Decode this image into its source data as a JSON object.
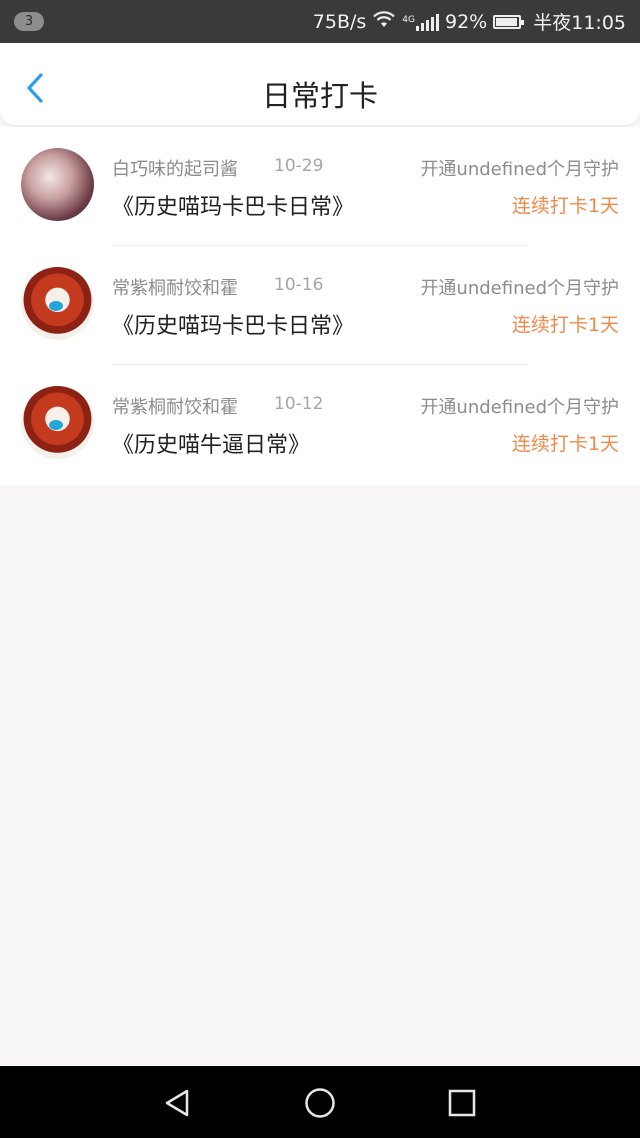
{
  "status_bar": {
    "notification_count": "3",
    "net_speed": "75B/s",
    "network_tag": "4G",
    "battery": "92%",
    "time": "半夜11:05",
    "icons": [
      "wifi-icon",
      "signal-icon",
      "battery-icon"
    ]
  },
  "header": {
    "title": "日常打卡",
    "back_icon": "chevron-left-icon",
    "accent_color": "#2f9ee8"
  },
  "checkins": [
    {
      "user": "白巧味的起司酱",
      "date": "10-29",
      "guard": "开通undefined个月守护",
      "book": "《历史喵玛卡巴卡日常》",
      "streak": "连续打卡1天",
      "avatar": "avatar-anime-girl"
    },
    {
      "user": "常紫桐耐饺和霍",
      "date": "10-16",
      "guard": "开通undefined个月守护",
      "book": "《历史喵玛卡巴卡日常》",
      "streak": "连续打卡1天",
      "avatar": "avatar-red-hair-character"
    },
    {
      "user": "常紫桐耐饺和霍",
      "date": "10-12",
      "guard": "开通undefined个月守护",
      "book": "《历史喵牛逼日常》",
      "streak": "连续打卡1天",
      "avatar": "avatar-red-hair-character"
    }
  ],
  "colors": {
    "streak": "#f08a4b",
    "muted_text": "#8c8c8c",
    "background": "#f8f6f7"
  },
  "system_nav": [
    "back-triangle-icon",
    "home-circle-icon",
    "recents-square-icon"
  ]
}
